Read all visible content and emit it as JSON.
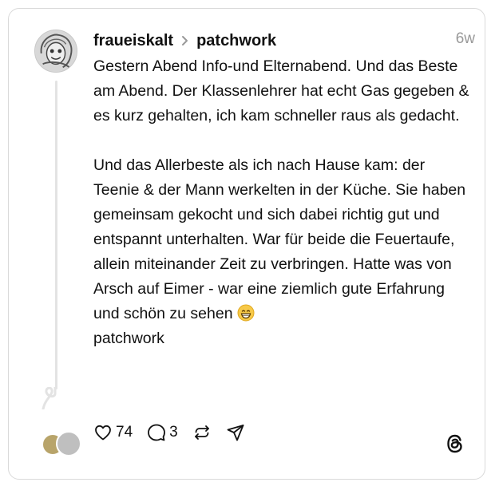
{
  "post": {
    "username": "fraueiskalt",
    "topic": "patchwork",
    "time": "6w",
    "paragraph1": "Gestern Abend Info-und Elternabend. Und das Beste am Abend. Der Klassenlehrer hat echt Gas gegeben & es kurz gehalten, ich kam schneller raus als gedacht.",
    "paragraph2": "Und das Allerbeste als ich nach Hause kam: der Teenie & der Mann werkelten in der Küche. Sie haben gemeinsam gekocht und sich dabei richtig gut und entspannt unterhalten. War für beide die Feuertaufe, allein miteinander Zeit zu verbringen. Hatte was von Arsch auf Eimer - war eine ziemlich gute Erfahrung und schön zu sehen",
    "emoji": "grinning-face-emoji",
    "tag": "patchwork"
  },
  "actions": {
    "likes": "74",
    "replies": "3"
  },
  "icons": {
    "like": "heart-icon",
    "reply": "speech-bubble-icon",
    "repost": "repost-icon",
    "share": "send-icon",
    "brand": "threads-logo-icon"
  },
  "colors": {
    "text": "#111111",
    "muted": "#999999",
    "border": "#d9d9d9"
  }
}
